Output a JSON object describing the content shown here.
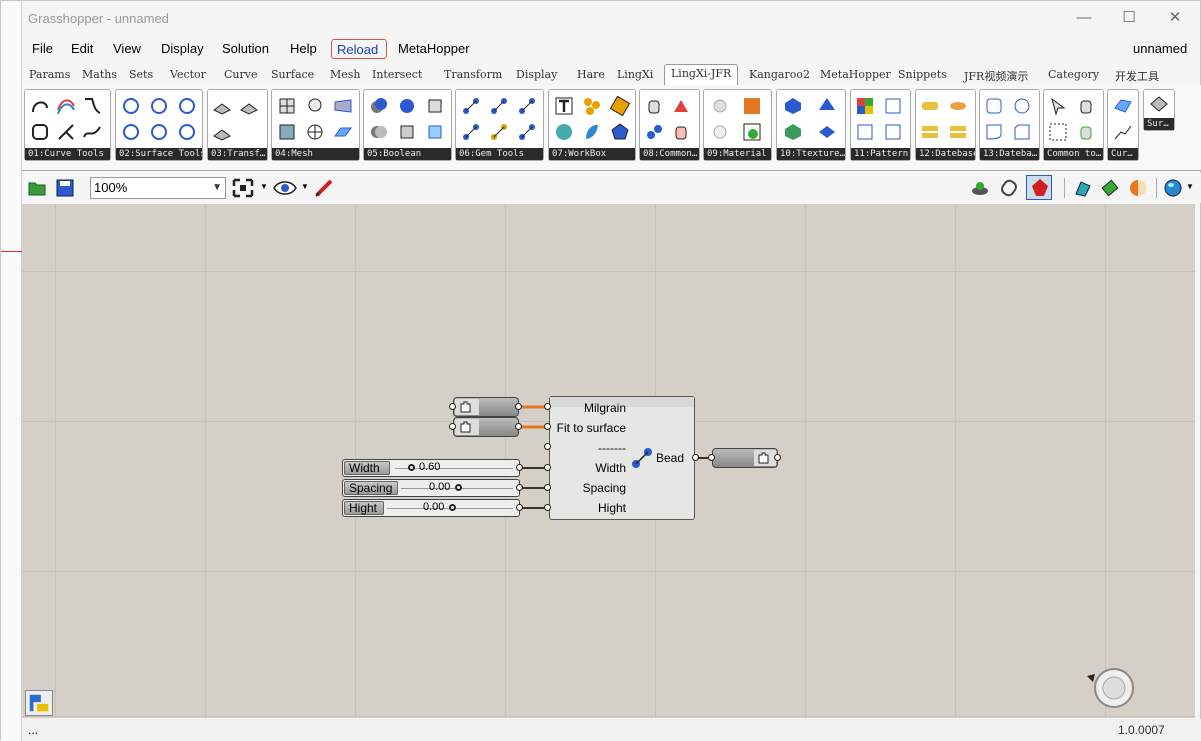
{
  "title": "Grasshopper - unnamed",
  "window_controls": {
    "minimize": "—",
    "maximize": "☐",
    "close": "✕"
  },
  "menu": [
    "File",
    "Edit",
    "View",
    "Display",
    "Solution",
    "Help"
  ],
  "reload_label": "Reload",
  "metahopper_label": "MetaHopper",
  "doc_name": "unnamed",
  "tabs": [
    "Params",
    "Maths",
    "Sets",
    "Vector",
    "Curve",
    "Surface",
    "Mesh",
    "Intersect",
    "Transform",
    "Display",
    "Hare",
    "LingXi",
    "LingXi-JFR",
    "Kangaroo2",
    "MetaHopper",
    "Snippets",
    "JFR视频演示",
    "Category",
    "开发工具"
  ],
  "active_tab": "LingXi-JFR",
  "groups": [
    "01:Curve Tools",
    "02:Surface Tools",
    "03:Transf…",
    "04:Mesh",
    "05:Boolean",
    "06:Gem Tools",
    "07:WorkBox",
    "08:Common…",
    "09:Material",
    "10:Ttexture…",
    "11:Pattern",
    "12:Datebase",
    "13:Dateba…",
    "Common to…",
    "Cur…"
  ],
  "surface_chip": "Sur…",
  "zoom": "100%",
  "component": {
    "inputs": [
      "Milgrain",
      "Fit to surface",
      "-------",
      "Width",
      "Spacing",
      "Hight"
    ],
    "output": "Bead"
  },
  "sliders": [
    {
      "name": "Width",
      "value": "0.60"
    },
    {
      "name": "Spacing",
      "value": "0.00"
    },
    {
      "name": "Hight",
      "value": "0.00"
    }
  ],
  "status_left": "...",
  "version": "1.0.0007",
  "colors": {
    "canvas": "#d4d0c8",
    "wire_on": "#e8742a",
    "reload_border": "#e05050"
  }
}
